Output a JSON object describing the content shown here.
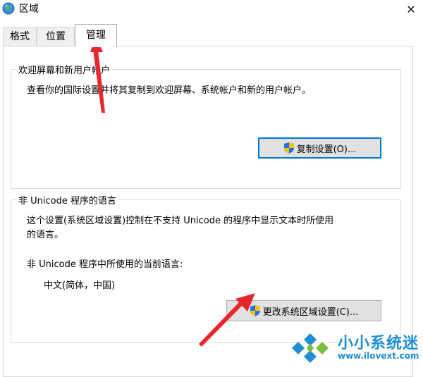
{
  "window": {
    "title": "区域",
    "close_glyph": "✕"
  },
  "tabs": [
    {
      "label": "格式",
      "active": false
    },
    {
      "label": "位置",
      "active": false
    },
    {
      "label": "管理",
      "active": true
    }
  ],
  "welcome_group": {
    "title": "欢迎屏幕和新用户帐户",
    "description": "查看你的国际设置并将其复制到欢迎屏幕、系统帐户和新的用户帐户。",
    "copy_button_label": "复制设置(O)..."
  },
  "unicode_group": {
    "title": "非 Unicode 程序的语言",
    "description_line1": "这个设置(系统区域设置)控制在不支持 Unicode 的程序中显示文本时所使用",
    "description_line2": "的语言。",
    "current_language_label": "非 Unicode 程序中所使用的当前语言:",
    "current_language_value": "中文(简体，中国)",
    "change_button_label": "更改系统区域设置(C)..."
  },
  "watermark": {
    "name": "小小系统迷",
    "url": "www.ilovext.com"
  },
  "colors": {
    "annotation_arrow": "#e8262d",
    "focus_border": "#0078d7",
    "watermark": "#1d8fd8"
  },
  "icons": {
    "app": "globe-icon",
    "uac": "shield-icon"
  }
}
